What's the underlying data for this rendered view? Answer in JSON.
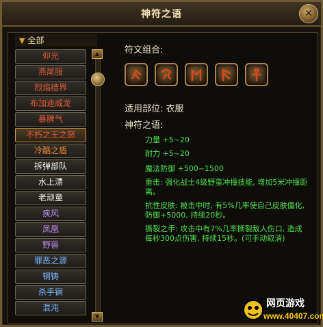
{
  "window": {
    "title": "神符之语"
  },
  "list": {
    "header": "全部",
    "items": [
      {
        "label": "仰光",
        "color": "#e05a3a"
      },
      {
        "label": "燕尾服",
        "color": "#e05a3a"
      },
      {
        "label": "烈焰结界",
        "color": "#e05a3a"
      },
      {
        "label": "布加迪威龙",
        "color": "#e05a3a"
      },
      {
        "label": "暴脾气",
        "color": "#e05a3a"
      },
      {
        "label": "不朽之王之怒",
        "color": "#e05a3a",
        "selected": true
      },
      {
        "label": "冷酷之盾",
        "color": "#f08a30"
      },
      {
        "label": "拆弹部队",
        "color": "#f3f3ea"
      },
      {
        "label": "水上漂",
        "color": "#f3f3ea"
      },
      {
        "label": "老顽童",
        "color": "#f3f3ea"
      },
      {
        "label": "疾风",
        "color": "#b98ae8"
      },
      {
        "label": "凤凰",
        "color": "#b98ae8"
      },
      {
        "label": "野兽",
        "color": "#b98ae8"
      },
      {
        "label": "罪恶之源",
        "color": "#7bb6ff"
      },
      {
        "label": "钢铸",
        "color": "#7bb6ff"
      },
      {
        "label": "杀手锏",
        "color": "#7bb6ff"
      },
      {
        "label": "混沌",
        "color": "#7bb6ff"
      }
    ]
  },
  "detail": {
    "rune_combo_label": "符文组合:",
    "runes": [
      "rune-1-icon",
      "rune-2-icon",
      "rune-3-icon",
      "rune-4-icon",
      "rune-5-icon"
    ],
    "slot_label": "适用部位: 衣服",
    "words_label": "神符之语:",
    "stats": [
      "力量 +5~20",
      "耐力 +5~20",
      "魔法防御 +500~1500"
    ],
    "effects": [
      "重击: 强化战士4级野蛮冲撞技能, 增加5米冲撞距离。",
      "抗性皮肤: 被击中时, 有5%几率使自己皮肤僵化, 防御+5000, 持续20秒。",
      "撕裂之手: 攻击中有7%几率撕裂敌人伤口, 造成每秒300点伤害, 持续15秒。(可手动取消)"
    ]
  },
  "watermark": {
    "text_top": "网页游戏",
    "text_bottom": "www.40407.com"
  }
}
